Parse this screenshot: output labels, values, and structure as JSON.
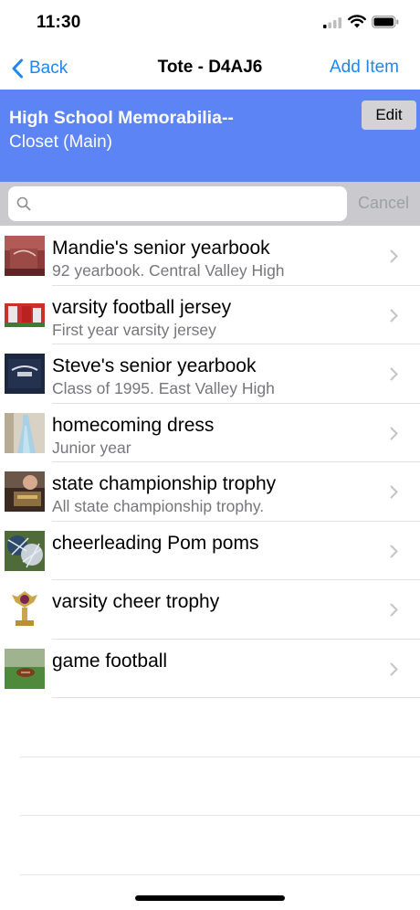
{
  "status_bar": {
    "time": "11:30"
  },
  "nav": {
    "back_label": "Back",
    "title": "Tote - D4AJ6",
    "add_label": "Add Item"
  },
  "header": {
    "title": "High School Memorabilia--",
    "subtitle": "Closet (Main)",
    "edit_label": "Edit"
  },
  "search": {
    "value": "",
    "placeholder": "",
    "cancel_label": "Cancel"
  },
  "items": [
    {
      "title": "Mandie's senior yearbook",
      "subtitle": "92 yearbook. Central Valley High",
      "thumb": "yearbook-red"
    },
    {
      "title": "varsity football jersey",
      "subtitle": "First year varsity jersey",
      "thumb": "jersey"
    },
    {
      "title": "Steve's senior yearbook",
      "subtitle": "Class of 1995. East Valley High",
      "thumb": "yearbook-navy"
    },
    {
      "title": "homecoming dress",
      "subtitle": "Junior year",
      "thumb": "dress"
    },
    {
      "title": "state championship trophy",
      "subtitle": "All state championship trophy.",
      "thumb": "trophy-photo"
    },
    {
      "title": "cheerleading Pom poms",
      "subtitle": "",
      "thumb": "pompoms"
    },
    {
      "title": "varsity cheer trophy",
      "subtitle": "",
      "thumb": "cheer-trophy"
    },
    {
      "title": "game football",
      "subtitle": "",
      "thumb": "football"
    }
  ],
  "colors": {
    "accent": "#1f86f0",
    "banner": "#5d84f4",
    "search_bg": "#c9c9ce"
  }
}
